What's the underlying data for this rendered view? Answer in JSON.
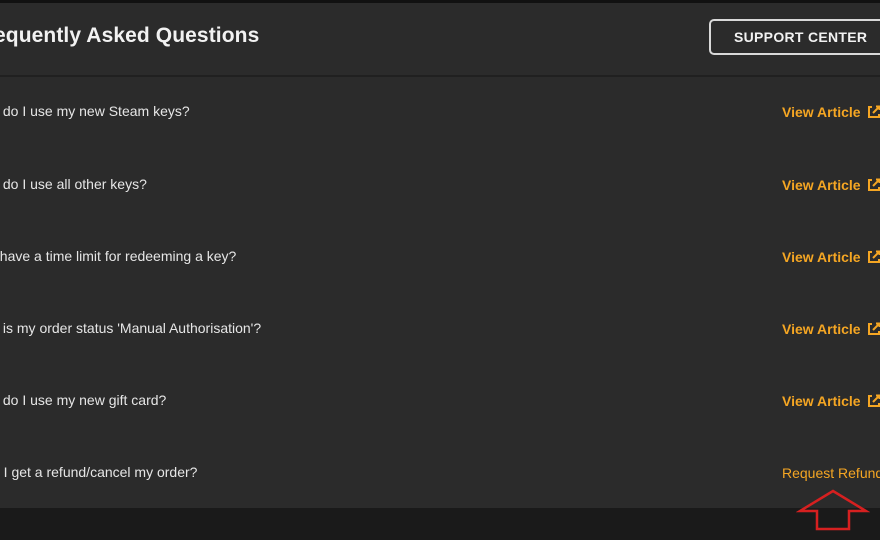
{
  "header": {
    "title": "equently Asked Questions",
    "support_button": "SUPPORT CENTER"
  },
  "faq": [
    {
      "question": "v do I use my new Steam keys?",
      "action": "View Article",
      "action_icon": "external-edit-icon"
    },
    {
      "question": "v do I use all other keys?",
      "action": "View Article",
      "action_icon": "external-edit-icon"
    },
    {
      "question": "I have a time limit for redeeming a key?",
      "action": "View Article",
      "action_icon": "external-edit-icon"
    },
    {
      "question": "y is my order status 'Manual Authorisation'?",
      "action": "View Article",
      "action_icon": "external-edit-icon"
    },
    {
      "question": "v do I use my new gift card?",
      "action": "View Article",
      "action_icon": "external-edit-icon"
    },
    {
      "question": "n I get a refund/cancel my order?",
      "action": "Request Refund"
    }
  ],
  "colors": {
    "panel_bg": "#2b2b2b",
    "page_bg": "#1c1c1c",
    "accent": "#f5a623",
    "text": "#e6e6e6",
    "annotation": "#d62020"
  },
  "annotation": {
    "icon": "up-arrow-icon"
  }
}
